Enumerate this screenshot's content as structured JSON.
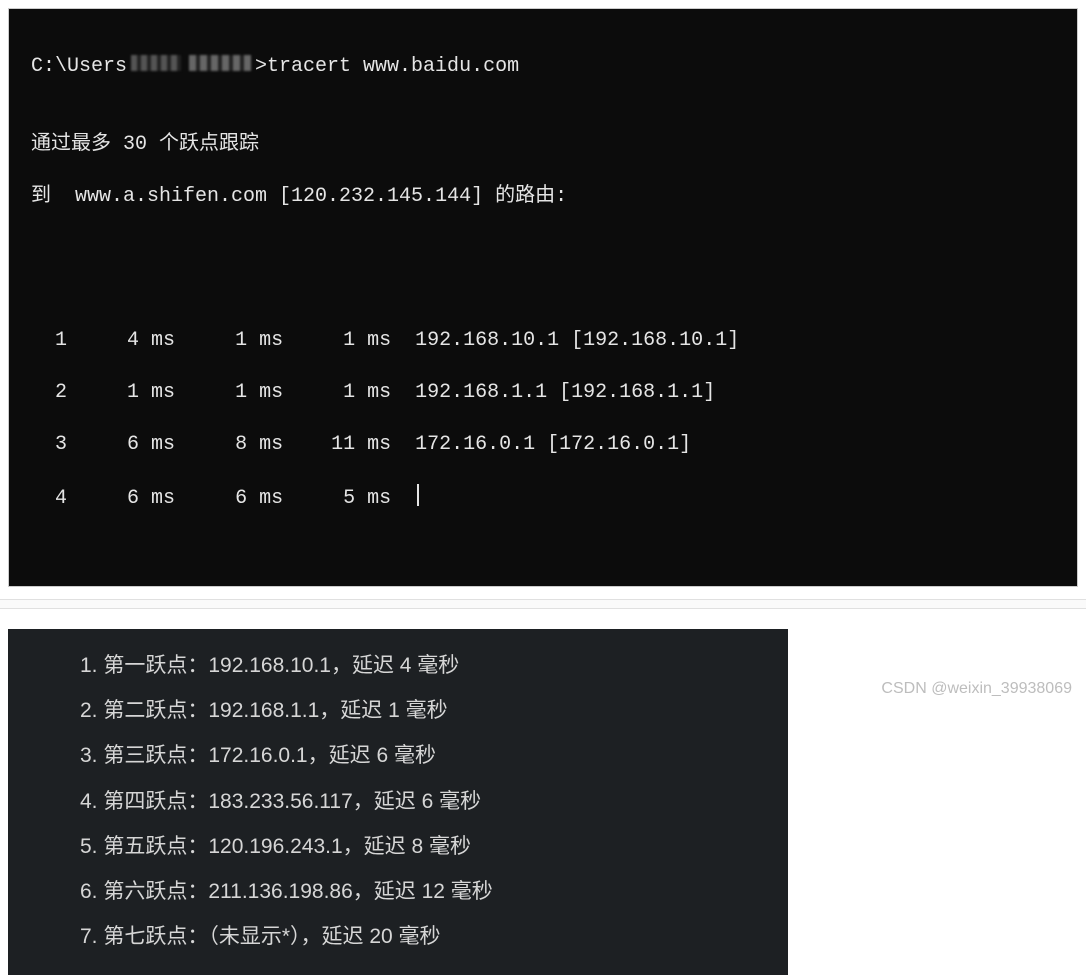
{
  "terminal": {
    "prompt_prefix": "C:\\Users",
    "command": "tracert www.baidu.com",
    "line1": "通过最多 30 个跃点跟踪",
    "line2": "到  www.a.shifen.com [120.232.145.144] 的路由:",
    "hops": [
      {
        "n": "1",
        "t1": "4 ms",
        "t2": "1 ms",
        "t3": "1 ms",
        "addr": "192.168.10.1 [192.168.10.1]"
      },
      {
        "n": "2",
        "t1": "1 ms",
        "t2": "1 ms",
        "t3": "1 ms",
        "addr": "192.168.1.1 [192.168.1.1]"
      },
      {
        "n": "3",
        "t1": "6 ms",
        "t2": "8 ms",
        "t3": "11 ms",
        "addr": "172.16.0.1 [172.16.0.1]"
      },
      {
        "n": "4",
        "t1": "6 ms",
        "t2": "6 ms",
        "t3": "5 ms",
        "addr": ""
      }
    ]
  },
  "summary": {
    "items": [
      "1. 第一跃点：192.168.10.1，延迟 4 毫秒",
      "2. 第二跃点：192.168.1.1，延迟 1 毫秒",
      "3. 第三跃点：172.16.0.1，延迟 6 毫秒",
      "4. 第四跃点：183.233.56.117，延迟 6 毫秒",
      "5. 第五跃点：120.196.243.1，延迟 8 毫秒",
      "6. 第六跃点：211.136.198.86，延迟 12 毫秒",
      "7. 第七跃点：（未显示*），延迟 20 毫秒"
    ]
  },
  "watermark": "CSDN @weixin_39938069"
}
